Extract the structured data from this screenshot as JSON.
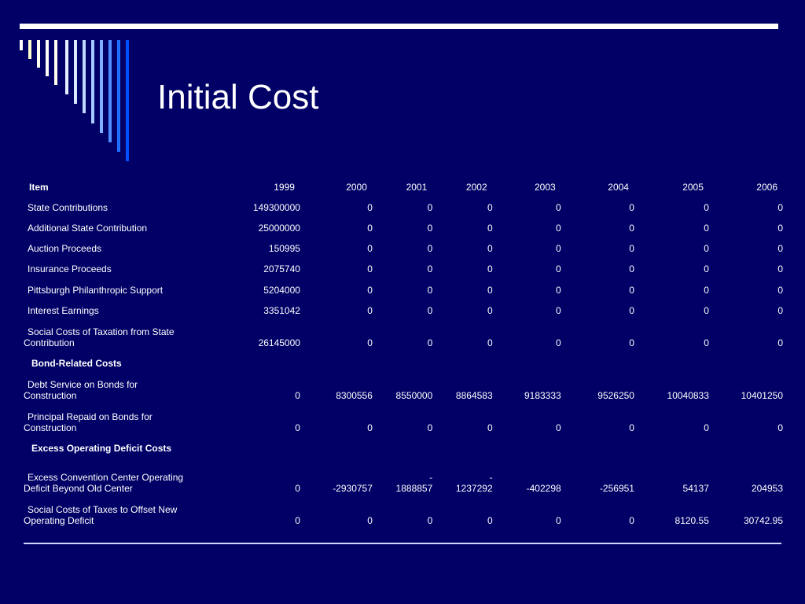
{
  "slide": {
    "title": "Initial Cost",
    "colors": {
      "background": "#000066",
      "text": "#ffffff"
    }
  },
  "table": {
    "columns": [
      "Item",
      "1999",
      "2000",
      "2001",
      "2002",
      "2003",
      "2004",
      "2005",
      "2006"
    ],
    "rows": [
      {
        "label": "State Contributions",
        "values": [
          "149300000",
          "0",
          "0",
          "0",
          "0",
          "0",
          "0",
          "0"
        ]
      },
      {
        "label": "Additional State Contribution",
        "values": [
          "25000000",
          "0",
          "0",
          "0",
          "0",
          "0",
          "0",
          "0"
        ]
      },
      {
        "label": "Auction Proceeds",
        "values": [
          "150995",
          "0",
          "0",
          "0",
          "0",
          "0",
          "0",
          "0"
        ]
      },
      {
        "label": "Insurance Proceeds",
        "values": [
          "2075740",
          "0",
          "0",
          "0",
          "0",
          "0",
          "0",
          "0"
        ]
      },
      {
        "label": "Pittsburgh Philanthropic Support",
        "values": [
          "5204000",
          "0",
          "0",
          "0",
          "0",
          "0",
          "0",
          "0"
        ]
      },
      {
        "label": "Interest Earnings",
        "values": [
          "3351042",
          "0",
          "0",
          "0",
          "0",
          "0",
          "0",
          "0"
        ]
      },
      {
        "label_line1": "Social Costs of Taxation from State",
        "label_line2": "Contribution",
        "values": [
          "26145000",
          "0",
          "0",
          "0",
          "0",
          "0",
          "0",
          "0"
        ]
      },
      {
        "section": "Bond-Related Costs"
      },
      {
        "label_line1": "Debt Service on Bonds for",
        "label_line2": "Construction",
        "values": [
          "0",
          "8300556",
          "8550000",
          "8864583",
          "9183333",
          "9526250",
          "10040833",
          "10401250"
        ]
      },
      {
        "label_line1": "Principal Repaid on Bonds for",
        "label_line2": "Construction",
        "values": [
          "0",
          "0",
          "0",
          "0",
          "0",
          "0",
          "0",
          "0"
        ]
      },
      {
        "section": "Excess Operating Deficit Costs"
      },
      {
        "label_line1": "Excess Convention Center Operating",
        "label_line2": "Deficit Beyond Old Center",
        "values": [
          "0",
          "-2930757",
          "1888857",
          "1237292",
          "-402298",
          "-256951",
          "54137",
          "204953"
        ],
        "dash_marks": [
          "",
          "",
          "-",
          "-",
          "",
          "",
          "",
          ""
        ]
      },
      {
        "label_line1": "Social Costs of Taxes to Offset New",
        "label_line2": "Operating Deficit",
        "values": [
          "0",
          "0",
          "0",
          "0",
          "0",
          "0",
          "8120.55",
          "30742.95"
        ]
      }
    ]
  }
}
